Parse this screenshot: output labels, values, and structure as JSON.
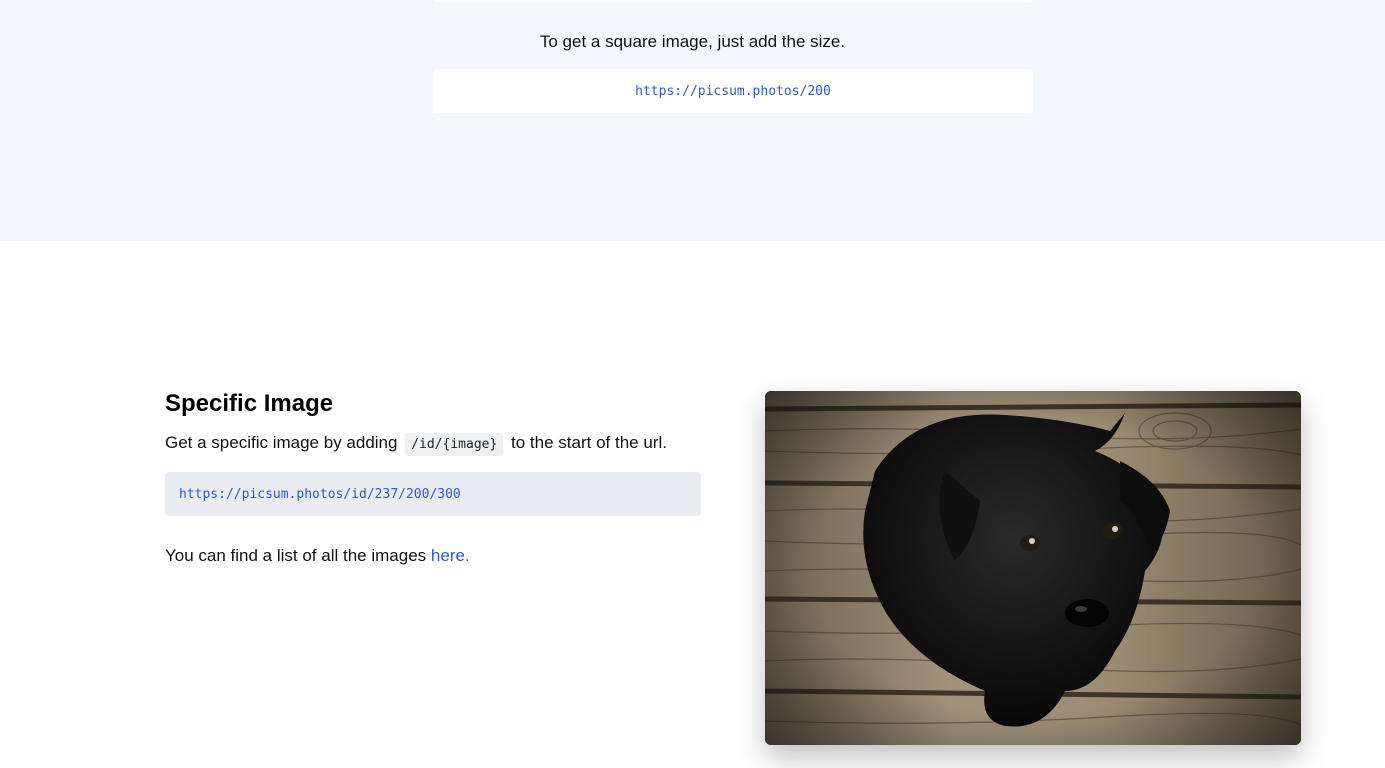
{
  "square": {
    "description": "To get a square image, just add the size.",
    "url": "https://picsum.photos/200"
  },
  "specific": {
    "heading": "Specific Image",
    "desc_before": "Get a specific image by adding",
    "desc_code": "/id/{image}",
    "desc_after": "to the start of the url.",
    "url": "https://picsum.photos/id/237/200/300",
    "list_text": "You can find a list of all the images",
    "list_link": "here."
  },
  "colors": {
    "top_background": "#f4f7fb",
    "link": "#2f57d6",
    "code_box": "#e9edf1"
  },
  "image": {
    "subject": "black-puppy-on-wooden-floor"
  }
}
